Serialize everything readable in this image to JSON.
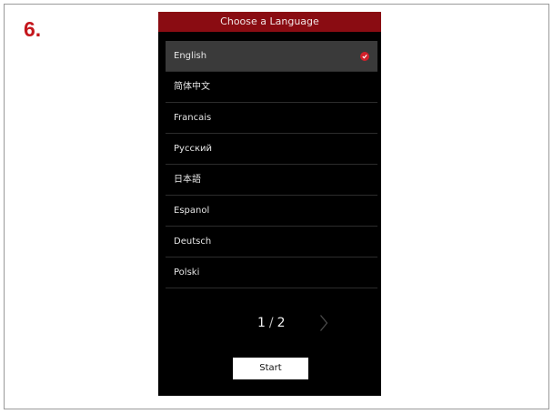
{
  "step_label": "6.",
  "screen": {
    "title": "Choose a Language",
    "languages": [
      {
        "label": "English",
        "selected": true
      },
      {
        "label": "简体中文",
        "selected": false
      },
      {
        "label": "Francais",
        "selected": false
      },
      {
        "label": "Русский",
        "selected": false
      },
      {
        "label": "日本語",
        "selected": false
      },
      {
        "label": "Espanol",
        "selected": false
      },
      {
        "label": "Deutsch",
        "selected": false
      },
      {
        "label": "Polski",
        "selected": false
      }
    ],
    "pager": {
      "current": "1",
      "separator": "/",
      "total": "2"
    },
    "start_label": "Start"
  },
  "colors": {
    "title_bar": "#8a0c12",
    "check": "#d2202a",
    "step_label": "#c4161c"
  },
  "icons": {
    "selected": "check-circle-icon",
    "next": "chevron-right-icon"
  }
}
